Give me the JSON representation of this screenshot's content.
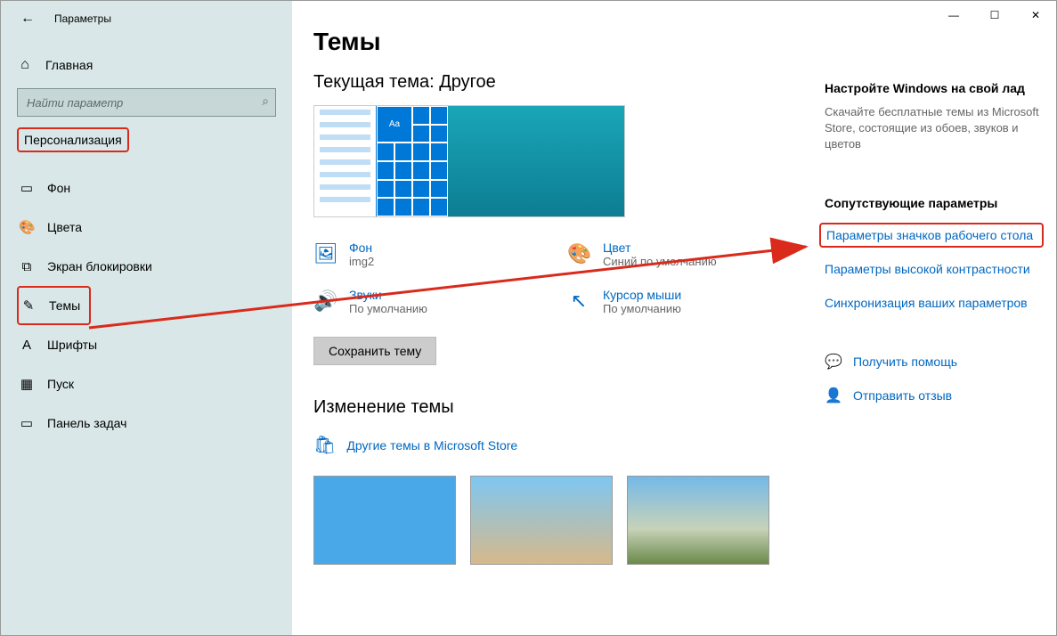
{
  "app_title": "Параметры",
  "search_placeholder": "Найти параметр",
  "home_label": "Главная",
  "section_label": "Персонализация",
  "nav_items": [
    {
      "label": "Фон"
    },
    {
      "label": "Цвета"
    },
    {
      "label": "Экран блокировки"
    },
    {
      "label": "Темы"
    },
    {
      "label": "Шрифты"
    },
    {
      "label": "Пуск"
    },
    {
      "label": "Панель задач"
    }
  ],
  "page_title": "Темы",
  "current_theme_label": "Текущая тема: Другое",
  "preview_tile_text": "Aa",
  "props": {
    "bg": {
      "title": "Фон",
      "value": "img2"
    },
    "color": {
      "title": "Цвет",
      "value": "Синий по умолчанию"
    },
    "sounds": {
      "title": "Звуки",
      "value": "По умолчанию"
    },
    "cursor": {
      "title": "Курсор мыши",
      "value": "По умолчанию"
    }
  },
  "save_btn": "Сохранить тему",
  "change_theme_heading": "Изменение темы",
  "store_link": "Другие темы в Microsoft Store",
  "right": {
    "customize_head": "Настройте Windows на свой лад",
    "customize_text": "Скачайте бесплатные темы из Microsoft Store, состоящие из обоев, звуков и цветов",
    "related_head": "Сопутствующие параметры",
    "link_desktop_icons": "Параметры значков рабочего стола",
    "link_high_contrast": "Параметры высокой контрастности",
    "link_sync": "Синхронизация ваших параметров",
    "help": "Получить помощь",
    "feedback": "Отправить отзыв"
  }
}
